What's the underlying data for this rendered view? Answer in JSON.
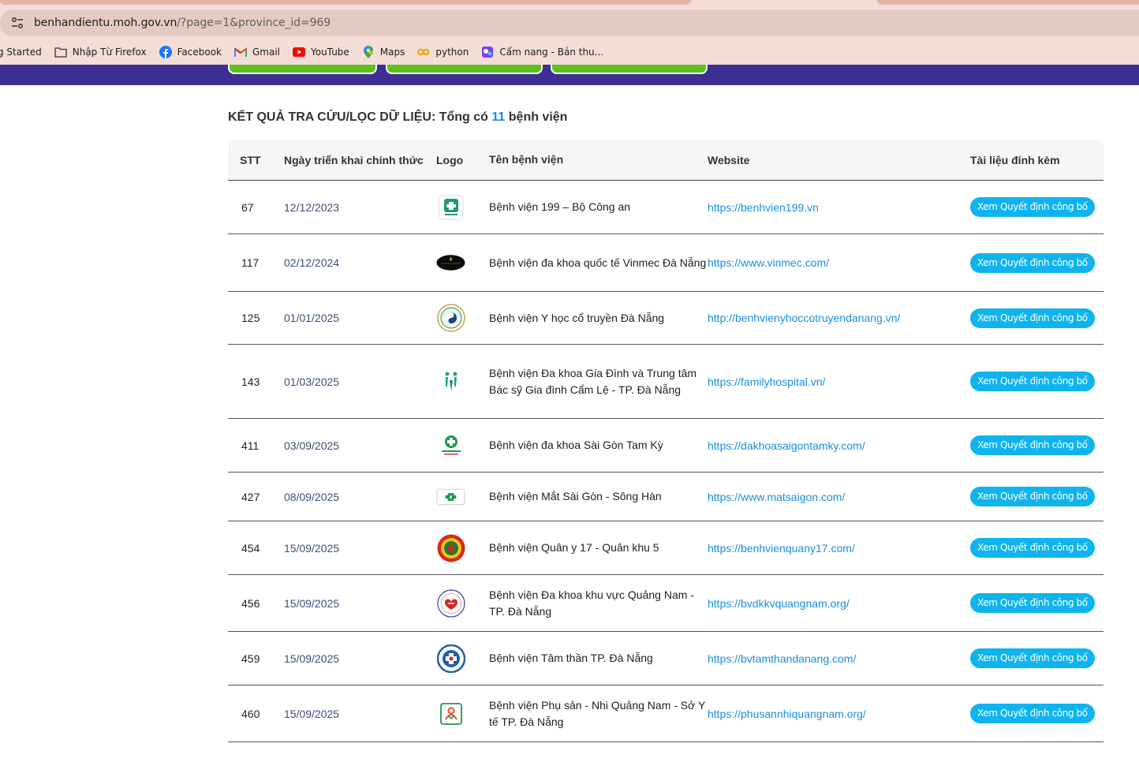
{
  "browser": {
    "url_host": "benhandientu.moh.gov.vn",
    "url_rest": "/?page=1&province_id=969",
    "bookmarks": [
      {
        "label": "g Started",
        "icon": "none"
      },
      {
        "label": "Nhập Từ Firefox",
        "icon": "folder-icon"
      },
      {
        "label": "Facebook",
        "icon": "facebook-icon"
      },
      {
        "label": "Gmail",
        "icon": "gmail-icon"
      },
      {
        "label": "YouTube",
        "icon": "youtube-icon"
      },
      {
        "label": "Maps",
        "icon": "maps-icon"
      },
      {
        "label": "python",
        "icon": "python-icon"
      },
      {
        "label": "Cẩm nang - Bản thu...",
        "icon": "camnang-icon"
      }
    ]
  },
  "results": {
    "title_prefix": "KẾT QUẢ TRA CỨU/LỌC DỮ LIỆU: Tổng có",
    "count": "11",
    "title_suffix": "bệnh viện"
  },
  "table": {
    "headers": {
      "stt": "STT",
      "date": "Ngày triển khai chính thức",
      "logo": "Logo",
      "name": "Tên bệnh viện",
      "website": "Website",
      "doc": "Tài liệu đính kèm"
    },
    "button_label": "Xem Quyết định công bố",
    "rows": [
      {
        "stt": "67",
        "date": "12/12/2023",
        "name": "Bệnh viện 199 – Bộ Công an",
        "website": "https://benhvien199.vn",
        "logo": "logo-199-icon"
      },
      {
        "stt": "117",
        "date": "02/12/2024",
        "name": "Bệnh viện đa khoa quốc tế Vinmec Đà Nẵng",
        "website": "https://www.vinmec.com/",
        "logo": "logo-vinmec-icon"
      },
      {
        "stt": "125",
        "date": "01/01/2025",
        "name": "Bệnh viện Y học cổ truyền Đà Nẵng",
        "website": "http://benhvienyhoccotruyendanang.vn/",
        "logo": "logo-yhct-icon"
      },
      {
        "stt": "143",
        "date": "01/03/2025",
        "name": "Bệnh viện Đa khoa Gia Đình và Trung tâm Bác sỹ Gia đình Cẩm Lệ - TP. Đà Nẵng",
        "website": "https://familyhospital.vn/",
        "logo": "logo-family-icon"
      },
      {
        "stt": "411",
        "date": "03/09/2025",
        "name": "Bệnh viện đa khoa Sài Gòn Tam Kỳ",
        "website": "https://dakhoasaigontamky.com/",
        "logo": "logo-saigon-tamky-icon"
      },
      {
        "stt": "427",
        "date": "08/09/2025",
        "name": "Bệnh viện Mắt Sài Gòn - Sông Hàn",
        "website": "https://www.matsaigon.com/",
        "logo": "logo-matsaigon-icon"
      },
      {
        "stt": "454",
        "date": "15/09/2025",
        "name": "Bệnh viện Quân y 17 - Quân khu 5",
        "website": "https://benhvienquany17.com/",
        "logo": "logo-quany17-icon"
      },
      {
        "stt": "456",
        "date": "15/09/2025",
        "name": "Bệnh viện Đa khoa khu vực Quảng Nam - TP. Đà Nẵng",
        "website": "https://bvdkkvquangnam.org/",
        "logo": "logo-bvdkkv-icon"
      },
      {
        "stt": "459",
        "date": "15/09/2025",
        "name": "Bệnh viện Tâm thần TP. Đà Nẵng",
        "website": "https://bvtamthandanang.com/",
        "logo": "logo-tamthan-icon"
      },
      {
        "stt": "460",
        "date": "15/09/2025",
        "name": "Bệnh viện Phụ sản - Nhi Quảng Nam - Sở Y tế TP. Đà Nẵng",
        "website": "https://phusannhiquangnam.org/",
        "logo": "logo-phusan-icon"
      }
    ]
  }
}
